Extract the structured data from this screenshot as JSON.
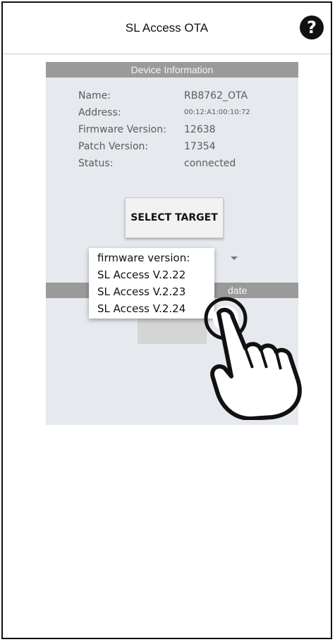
{
  "app": {
    "title": "SL Access OTA",
    "help_icon": "?"
  },
  "device_info": {
    "header": "Device Information",
    "rows": [
      {
        "label": "Name:",
        "value": "RB8762_OTA"
      },
      {
        "label": "Address:",
        "value": "00:12:A1:00:10:72"
      },
      {
        "label": "Firmware Version:",
        "value": "12638"
      },
      {
        "label": "Patch Version:",
        "value": "17354"
      },
      {
        "label": "Status:",
        "value": "connected"
      }
    ]
  },
  "buttons": {
    "select_target": "SELECT TARGET"
  },
  "update_section": {
    "header_visible_text": "date"
  },
  "dropdown": {
    "items": [
      "firmware version:",
      "SL Access V.2.22",
      "SL Access V.2.23",
      "SL Access V.2.24"
    ]
  },
  "colors": {
    "panel_bg": "#e6e9ed",
    "header_bg": "#9a9a9a"
  }
}
